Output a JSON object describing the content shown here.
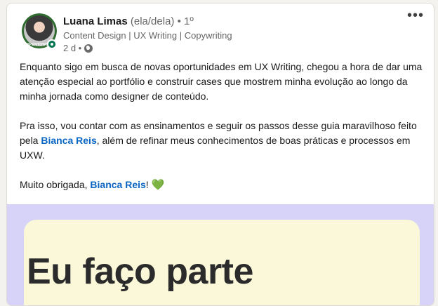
{
  "post": {
    "author": {
      "name": "Luana Limas",
      "pronouns": "(ela/dela)",
      "degree": "• 1º",
      "headline": "Content Design | UX Writing | Copywriting",
      "time": "2 d •",
      "avatar_tag": "#OPENTOWORK",
      "online_color": "#01754f"
    },
    "more_label": "•••",
    "paragraphs": [
      {
        "text": "Enquanto sigo em busca de novas oportunidades em UX Writing, chegou a hora de dar uma atenção especial ao portfólio e construir cases que mostrem minha evolução ao longo da minha jornada como designer de conteúdo."
      },
      {
        "text_before": "Pra isso, vou contar com as ensinamentos e seguir os passos desse guia maravilhoso feito pela ",
        "mention": "Bianca Reis",
        "text_after": ", além de refinar meus conhecimentos de boas práticas e processos em UXW."
      },
      {
        "text_before": "Muito obrigada, ",
        "mention": "Bianca Reis",
        "text_after": "! ",
        "emoji": "💚"
      }
    ],
    "media": {
      "title": "Eu faço parte",
      "background": "#d7d2f7",
      "card_color": "#fbf7d9"
    },
    "colors": {
      "mention": "#0a66c2",
      "text": "#191919",
      "muted": "#666666"
    }
  }
}
